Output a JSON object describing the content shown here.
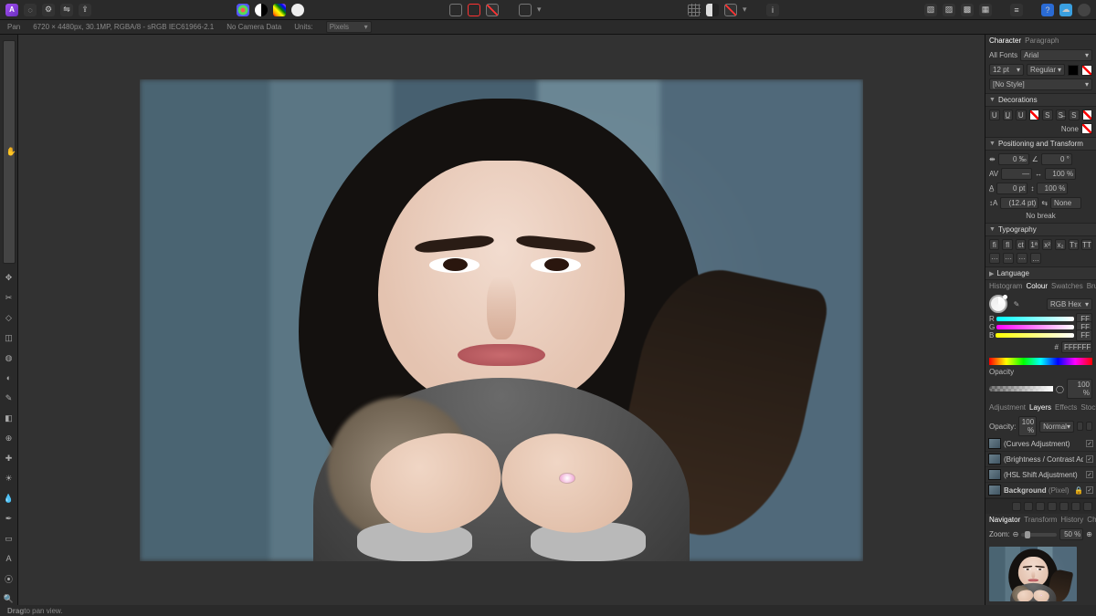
{
  "topbar": {
    "appBadge": "A",
    "persona": {
      "tooltip_left": "Photo",
      "tooltip_right": "Liquify"
    }
  },
  "infostrip": {
    "tool": "Pan",
    "docinfo": "6720 × 4480px, 30.1MP, RGBA/8 - sRGB IEC61966-2.1",
    "camera": "No Camera Data",
    "units_label": "Units:",
    "units_value": "Pixels"
  },
  "toolnames": [
    "hand",
    "move",
    "crop",
    "node",
    "marquee",
    "flood",
    "gradient",
    "brush",
    "erase",
    "clone",
    "heal",
    "dodge",
    "blur",
    "pen",
    "rect",
    "text",
    "colorpick",
    "zoom"
  ],
  "charPanel": {
    "tabs": [
      "Character",
      "Paragraph"
    ],
    "fontListLabel": "All Fonts",
    "fontFamily": "Arial",
    "fontSize": "12 pt",
    "fontWeight": "Regular",
    "style": "[No Style]",
    "decorations": "Decorations",
    "noneLabel": "None",
    "posTransform": "Positioning and Transform",
    "values": {
      "tracking": "0 ‰",
      "shear": "0 °",
      "baseline": "0 pt",
      "scaleX": "100 %",
      "leading": "(12.4 pt)",
      "override": "None",
      "scaleY": "100 %",
      "noBreak": "No break"
    },
    "typography": "Typography",
    "language": "Language"
  },
  "colorPanel": {
    "tabs": [
      "Histogram",
      "Colour",
      "Swatches",
      "Brushes"
    ],
    "modeLabel": "RGB Hex",
    "channels": [
      "R",
      "G",
      "B"
    ],
    "channelVals": [
      "FF",
      "FF",
      "FF"
    ],
    "hexLabel": "#",
    "hexValue": "FFFFFF",
    "opacityLabel": "Opacity",
    "opacityValue": "100 %"
  },
  "layersPanel": {
    "tabs": [
      "Adjustment",
      "Layers",
      "Effects",
      "Stock"
    ],
    "opacityLabel": "Opacity:",
    "opacityValue": "100 %",
    "blendMode": "Normal",
    "layers": [
      {
        "name": "(Curves Adjustment)",
        "checked": true
      },
      {
        "name": "(Brightness / Contrast Adjustment)",
        "checked": true
      },
      {
        "name": "(HSL Shift Adjustment)",
        "checked": true
      },
      {
        "name": "Background",
        "suffix": "(Pixel)",
        "checked": true,
        "locked": true
      }
    ]
  },
  "navPanel": {
    "tabs": [
      "Navigator",
      "Transform",
      "History",
      "Channels"
    ],
    "zoomLabel": "Zoom:",
    "zoomValue": "50 %"
  },
  "statusbar": {
    "hint_bold": "Drag",
    "hint_rest": " to pan view."
  }
}
